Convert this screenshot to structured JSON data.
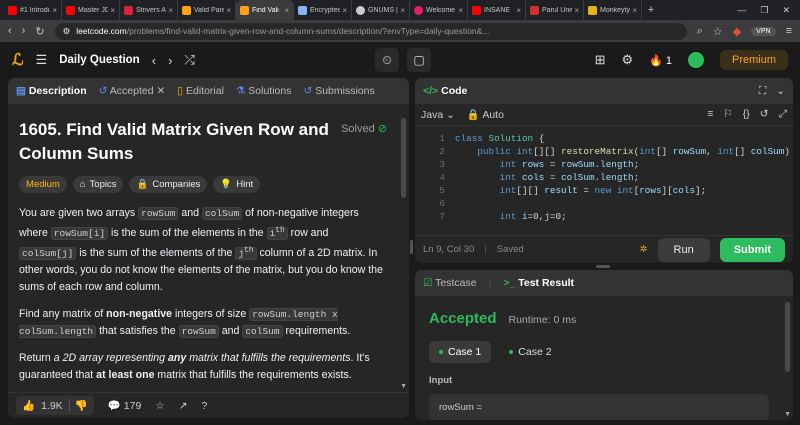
{
  "browser": {
    "tabs": [
      {
        "label": "#1 Introducti",
        "color": "#ff0000"
      },
      {
        "label": "Master JDBC",
        "color": "#ff0000"
      },
      {
        "label": "Strivers A2Z",
        "color": "#e0203a"
      },
      {
        "label": "Valid Parenth",
        "color": "#ffa116"
      },
      {
        "label": "Find Vali",
        "color": "#ffa116"
      },
      {
        "label": "Encrypted or",
        "color": "#8ab4f8"
      },
      {
        "label": "GNUMS | Par",
        "color": "#cccccc"
      },
      {
        "label": "Welcome - U",
        "color": "#e91e63"
      },
      {
        "label": "INSANE",
        "color": "#ff0000"
      },
      {
        "label": "Parul Univer",
        "color": "#d32f2f"
      },
      {
        "label": "Monkeytype",
        "color": "#e2b714"
      }
    ],
    "url_host": "leetcode.com",
    "url_path": "/problems/find-valid-matrix-given-row-and-column-sums/description/?envType=daily-question&...",
    "vpn_label": "VPN"
  },
  "nav": {
    "title": "Daily Question",
    "streak": "1",
    "premium": "Premium"
  },
  "desc_panel": {
    "tabs": [
      "Description",
      "Accepted",
      "Editorial",
      "Solutions",
      "Submissions"
    ],
    "title": "1605. Find Valid Matrix Given Row and Column Sums",
    "solved": "Solved",
    "chips": [
      "Medium",
      "Topics",
      "Companies",
      "Hint"
    ],
    "p1": {
      "t1": "You are given two arrays ",
      "c1": "rowSum",
      "t2": " and ",
      "c2": "colSum",
      "t3": " of non-negative integers where ",
      "c3": "rowSum[i]",
      "t4": " is the sum of the elements in the ",
      "sup1a": "i",
      "sup1b": "th",
      "t5": " row and ",
      "c4": "colSum[j]",
      "t6": " is the sum of the elements of the ",
      "sup2a": "j",
      "sup2b": "th",
      "t7": " column of a 2D matrix. In other words, you do not know the elements of the matrix, but you do know the sums of each row and column."
    },
    "p2": {
      "t1": "Find any matrix of ",
      "b1": "non-negative",
      "t2": " integers of size ",
      "c1": "rowSum.length x colSum.length",
      "t3": " that satisfies the ",
      "c2": "rowSum",
      "t4": " and ",
      "c3": "colSum",
      "t5": " requirements."
    },
    "p3": {
      "t1": "Return ",
      "i1": "a 2D array representing ",
      "bi": "any",
      "i2": " matrix that fulfills the requirements",
      "t2": ". It's guaranteed that ",
      "b1": "at least one",
      "t3": " matrix that fulfills the requirements exists."
    },
    "likes": "1.9K",
    "comments": "179"
  },
  "code_panel": {
    "title": "Code",
    "language": "Java",
    "auto": "Auto",
    "lines": [
      "1",
      "2",
      "3",
      "4",
      "5",
      "6",
      "7"
    ],
    "cursor": "Ln 9, Col 30",
    "saved": "Saved",
    "run": "Run",
    "submit": "Submit"
  },
  "result_panel": {
    "tab_testcase": "Testcase",
    "tab_result": "Test Result",
    "status": "Accepted",
    "runtime": "Runtime: 0 ms",
    "cases": [
      "Case 1",
      "Case 2"
    ],
    "input_label": "Input",
    "input_value": "rowSum ="
  }
}
